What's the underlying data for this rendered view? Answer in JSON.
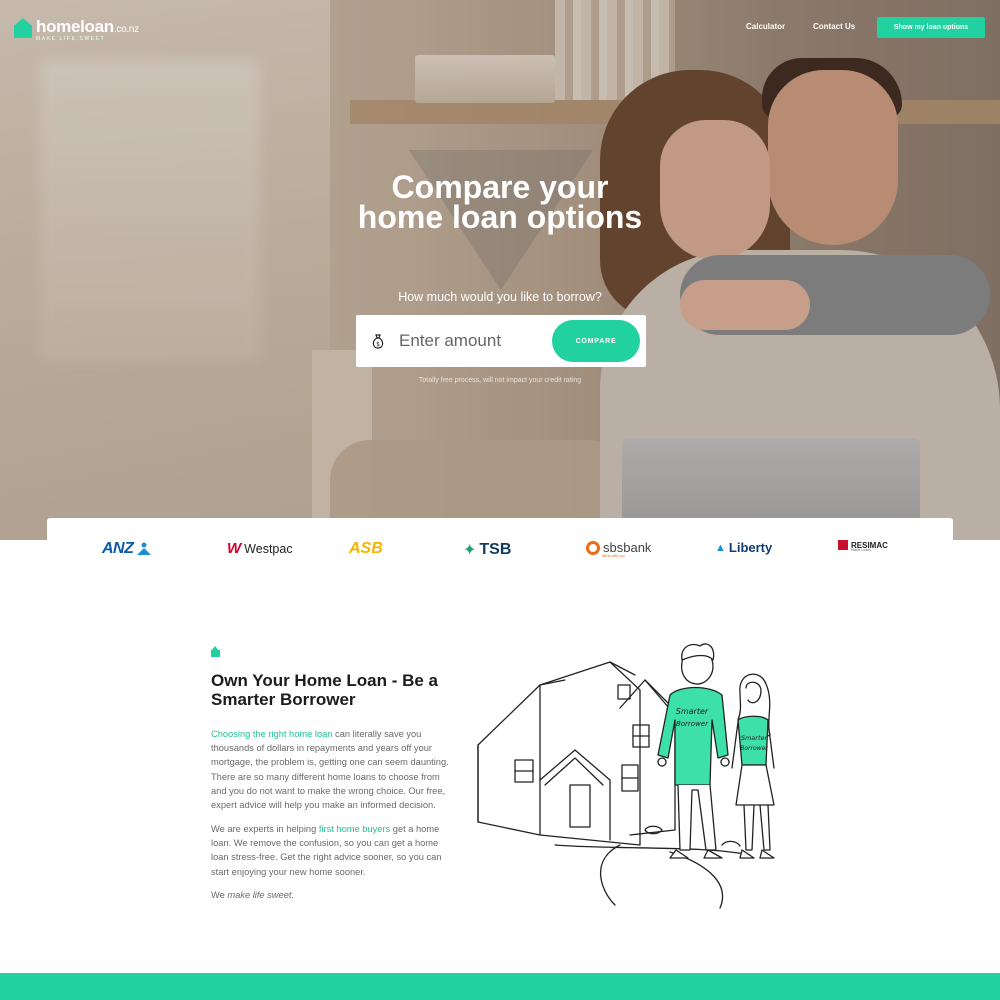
{
  "brand": {
    "name": "homeloan",
    "domain": ".co.nz",
    "tagline": "MAKE LIFE SWEET",
    "accent_color": "#22d1a0"
  },
  "nav": {
    "links": [
      "Calculator",
      "Contact Us"
    ],
    "cta": "Show my loan options"
  },
  "hero": {
    "title": "Compare your home loan options",
    "question": "How much would you like to borrow?",
    "input_placeholder": "Enter amount",
    "input_icon": "money-bag-icon",
    "button": "COMPARE",
    "note": "Totally free process, will not impact your credit rating"
  },
  "lenders": [
    {
      "name": "ANZ"
    },
    {
      "name": "Westpac"
    },
    {
      "name": "ASB"
    },
    {
      "name": "TSB"
    },
    {
      "name": "sbsbank",
      "sub": "We're with you"
    },
    {
      "name": "Liberty"
    },
    {
      "name": "RESIMAC",
      "sub": "Home Loans"
    }
  ],
  "content": {
    "title": "Own Your Home Loan - Be a Smarter Borrower",
    "p1_link": "Choosing the right home loan",
    "p1_text": " can literally save you thousands of dollars in repayments and years off your mortgage, the problem is, getting one can seem daunting. There are so many different home loans to choose from and you do not want to make the wrong choice. Our free, expert advice will help you make an informed decision.",
    "p2_before": "We are experts in helping ",
    "p2_link": "first home buyers",
    "p2_after": " get a home loan. We remove the confusion, so you can get a home loan stress-free. Get the right advice sooner, so you can start enjoying your new home sooner.",
    "p3_before": "We ",
    "p3_em": "make life sweet."
  },
  "illustration": {
    "shirt_text_1": "Smarter",
    "shirt_text_2": "Borrower"
  }
}
